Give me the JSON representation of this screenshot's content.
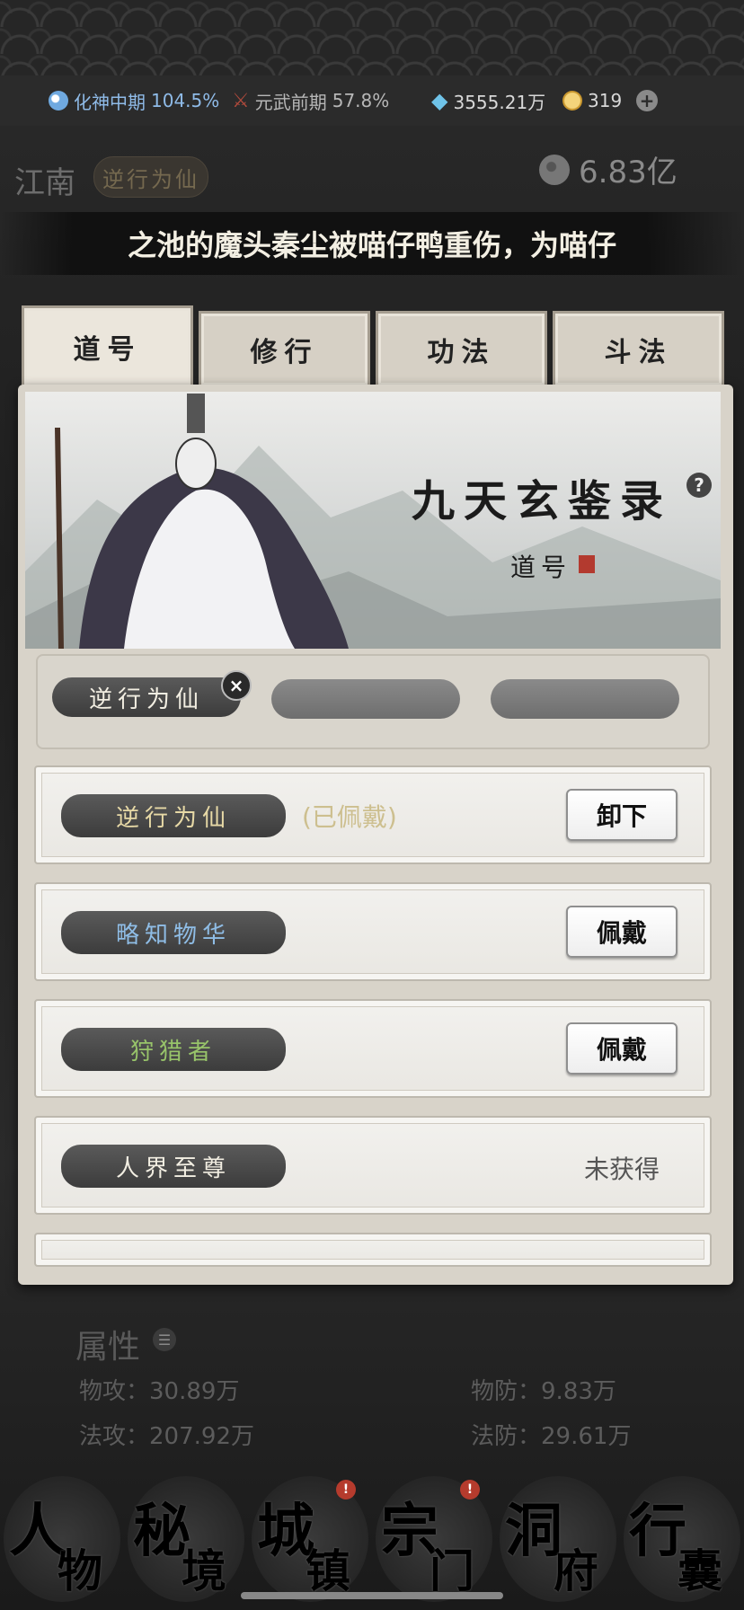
{
  "status_bar": {
    "realm_a_name": "化神中期",
    "realm_a_pct": "104.5%",
    "realm_b_name": "元武前期",
    "realm_b_pct": "57.8%",
    "crystals": "3555.21万",
    "coins": "319"
  },
  "header": {
    "region": "江南",
    "title_tag": "逆行为仙",
    "money": "6.83亿"
  },
  "ticker": {
    "text": "之池的魔头秦尘被喵仔鸭重伤，为喵仔"
  },
  "tabs": [
    {
      "label": "道号"
    },
    {
      "label": "修行"
    },
    {
      "label": "功法"
    },
    {
      "label": "斗法"
    }
  ],
  "banner": {
    "title": "九天玄鉴录",
    "subtitle": "道号"
  },
  "equipped_slots": {
    "slot1": "逆行为仙",
    "slot2": "",
    "slot3": ""
  },
  "titles_list": [
    {
      "name": "逆行为仙",
      "state": "(已佩戴)",
      "button": "卸下",
      "color": "#e7d9a6"
    },
    {
      "name": "略知物华",
      "state": "",
      "button": "佩戴",
      "color": "#8fbde6"
    },
    {
      "name": "狩猎者",
      "state": "",
      "button": "佩戴",
      "color": "#98c46a"
    },
    {
      "name": "人界至尊",
      "state": "未获得",
      "button": "",
      "color": "#f2eee2"
    }
  ],
  "attributes": {
    "title": "属性",
    "phys_atk_label": "物攻：",
    "phys_atk": "30.89万",
    "phys_def_label": "物防：",
    "phys_def": "9.83万",
    "mag_atk_label": "法攻：",
    "mag_atk": "207.92万",
    "mag_def_label": "法防：",
    "mag_def": "29.61万"
  },
  "bottom_nav": [
    {
      "big": "人",
      "small": "物",
      "badge": ""
    },
    {
      "big": "秘",
      "small": "境",
      "badge": ""
    },
    {
      "big": "城",
      "small": "镇",
      "badge": "!"
    },
    {
      "big": "宗",
      "small": "门",
      "badge": "!"
    },
    {
      "big": "洞",
      "small": "府",
      "badge": ""
    },
    {
      "big": "行",
      "small": "囊",
      "badge": ""
    }
  ],
  "colors": {
    "accent_gold": "#e7d9a6",
    "accent_blue": "#8fbbe8",
    "badge_red": "#b53b2d"
  }
}
